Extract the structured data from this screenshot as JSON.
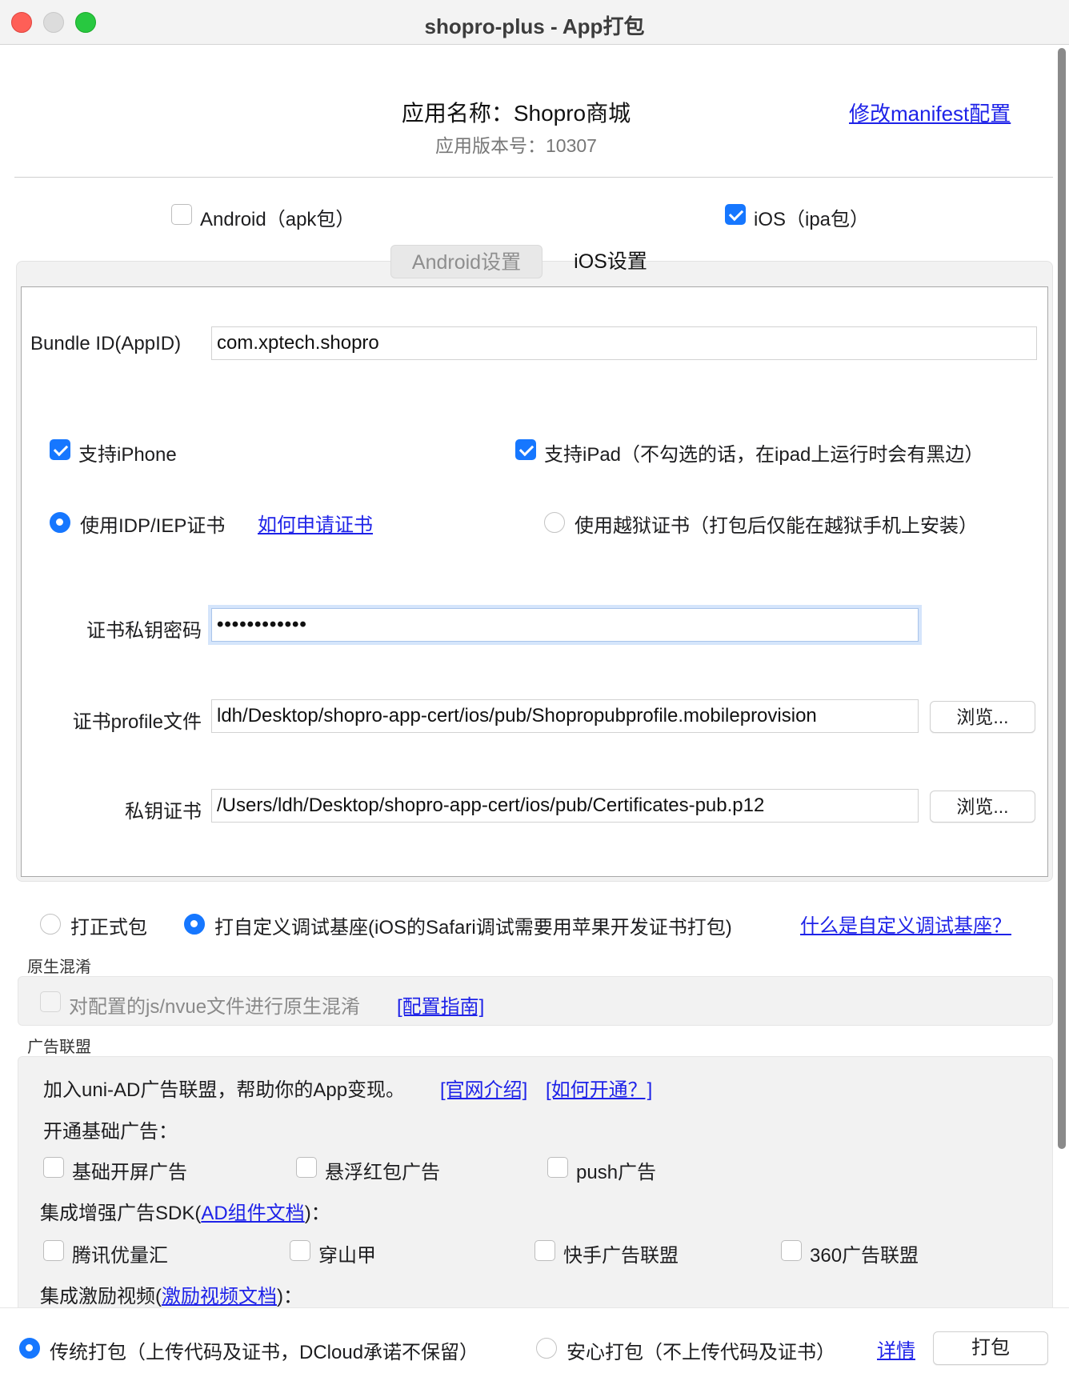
{
  "window": {
    "title": "shopro-plus - App打包"
  },
  "header": {
    "app_name": "应用名称：Shopro商城",
    "app_version": "应用版本号：10307",
    "manifest_link": "修改manifest配置"
  },
  "platforms": {
    "android": {
      "label": "Android（apk包）",
      "checked": false
    },
    "ios": {
      "label": "iOS（ipa包）",
      "checked": true
    }
  },
  "tabs": [
    {
      "label": "Android设置",
      "active": false
    },
    {
      "label": "iOS设置",
      "active": true
    }
  ],
  "ios_settings": {
    "bundle_id_label": "Bundle ID(AppID)",
    "bundle_id_value": "com.xptech.shopro",
    "support_iphone": {
      "label": "支持iPhone",
      "checked": true
    },
    "support_ipad": {
      "label": "支持iPad（不勾选的话，在ipad上运行时会有黑边）",
      "checked": true
    },
    "cert_idp": {
      "label": "使用IDP/IEP证书",
      "checked": true
    },
    "how_to_apply_link": "如何申请证书",
    "cert_jailbreak": {
      "label": "使用越狱证书（打包后仅能在越狱手机上安装）",
      "checked": false
    },
    "key_password_label": "证书私钥密码",
    "key_password_value": "••••••••••••",
    "profile_label": "证书profile文件",
    "profile_value": "ldh/Desktop/shopro-app-cert/ios/pub/Shopropubprofile.mobileprovision",
    "private_key_label": "私钥证书",
    "private_key_value": "/Users/ldh/Desktop/shopro-app-cert/ios/pub/Certificates-pub.p12",
    "browse_label": "浏览..."
  },
  "build_type": {
    "release": {
      "label": "打正式包",
      "checked": false
    },
    "custom_base": {
      "label": "打自定义调试基座(iOS的Safari调试需要用苹果开发证书打包)",
      "checked": true
    },
    "what_is_link": "什么是自定义调试基座？"
  },
  "obfuscation": {
    "section_title": "原生混淆",
    "option_label": "对配置的js/nvue文件进行原生混淆",
    "guide_link": "[配置指南]"
  },
  "ads": {
    "section_title": "广告联盟",
    "intro_text": "加入uni-AD广告联盟，帮助你的App变现。",
    "intro_link1": "[官网介绍]",
    "intro_link2": "[如何开通？]",
    "basic_title": "开通基础广告：",
    "basic_options": [
      "基础开屏广告",
      "悬浮红包广告",
      "push广告"
    ],
    "sdk_title_prefix": "集成增强广告SDK(",
    "sdk_link": "AD组件文档",
    "sdk_title_suffix": ")：",
    "sdk_options": [
      "腾讯优量汇",
      "穿山甲",
      "快手广告联盟",
      "360广告联盟"
    ],
    "video_title_prefix": "集成激励视频(",
    "video_link": "激励视频文档",
    "video_title_suffix": ")："
  },
  "footer": {
    "traditional": {
      "label": "传统打包（上传代码及证书，DCloud承诺不保留）",
      "checked": true
    },
    "safe": {
      "label": "安心打包（不上传代码及证书）",
      "checked": false
    },
    "details_link": "详情",
    "pack_button": "打包"
  }
}
